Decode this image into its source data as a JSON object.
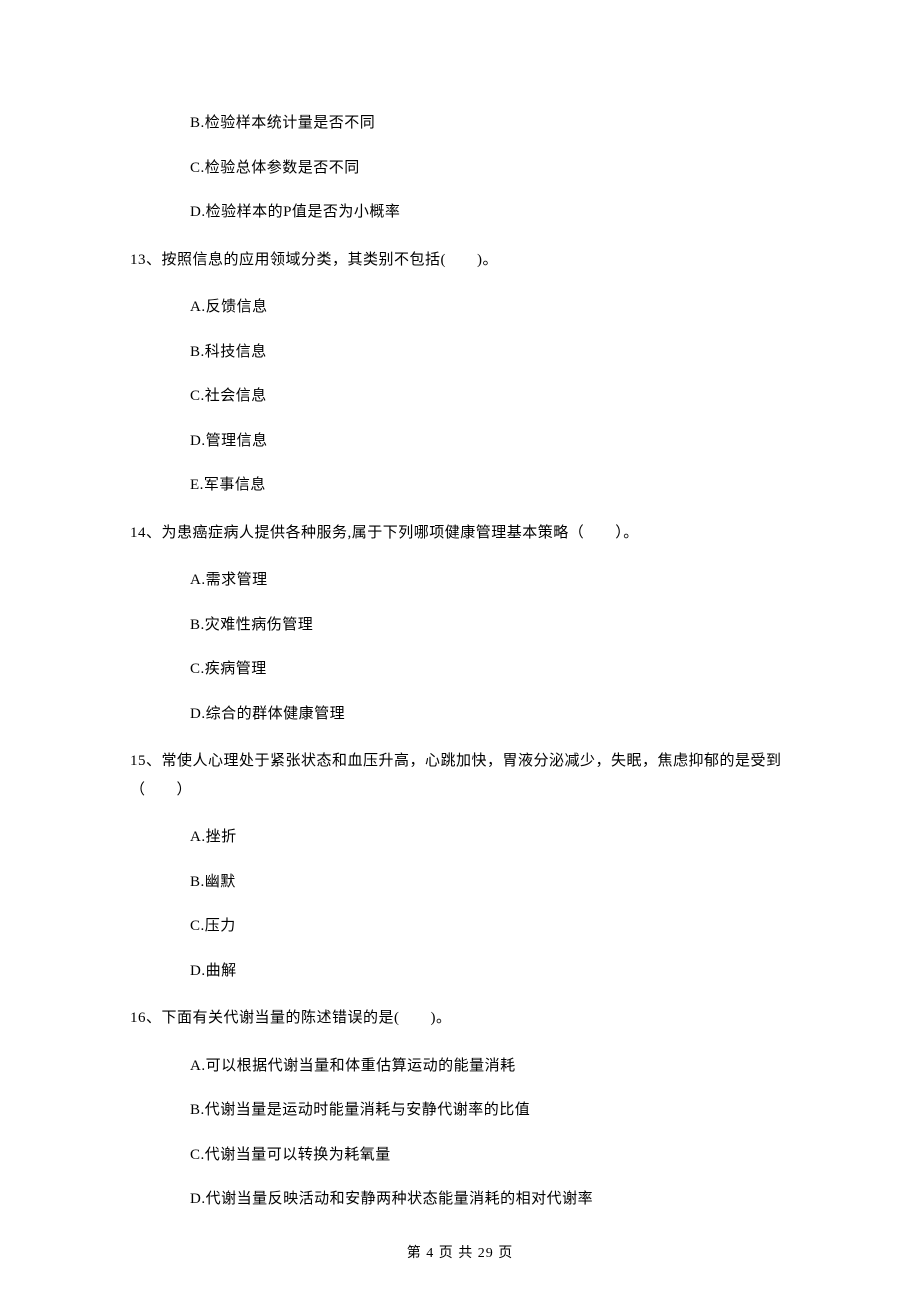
{
  "options_q12": [
    "B.检验样本统计量是否不同",
    "C.检验总体参数是否不同",
    "D.检验样本的P值是否为小概率"
  ],
  "q13": {
    "text": "13、按照信息的应用领域分类，其类别不包括(　　)。",
    "options": [
      "A.反馈信息",
      "B.科技信息",
      "C.社会信息",
      "D.管理信息",
      "E.军事信息"
    ]
  },
  "q14": {
    "text": "14、为患癌症病人提供各种服务,属于下列哪项健康管理基本策略（　　）。",
    "options": [
      "A.需求管理",
      "B.灾难性病伤管理",
      "C.疾病管理",
      "D.综合的群体健康管理"
    ]
  },
  "q15": {
    "text": "15、常使人心理处于紧张状态和血压升高，心跳加快，胃液分泌减少，失眠，焦虑抑郁的是受到（　　）",
    "options": [
      "A.挫折",
      "B.幽默",
      "C.压力",
      "D.曲解"
    ]
  },
  "q16": {
    "text": "16、下面有关代谢当量的陈述错误的是(　　)。",
    "options": [
      "A.可以根据代谢当量和体重估算运动的能量消耗",
      "B.代谢当量是运动时能量消耗与安静代谢率的比值",
      "C.代谢当量可以转换为耗氧量",
      "D.代谢当量反映活动和安静两种状态能量消耗的相对代谢率"
    ]
  },
  "footer": "第 4 页 共 29 页"
}
